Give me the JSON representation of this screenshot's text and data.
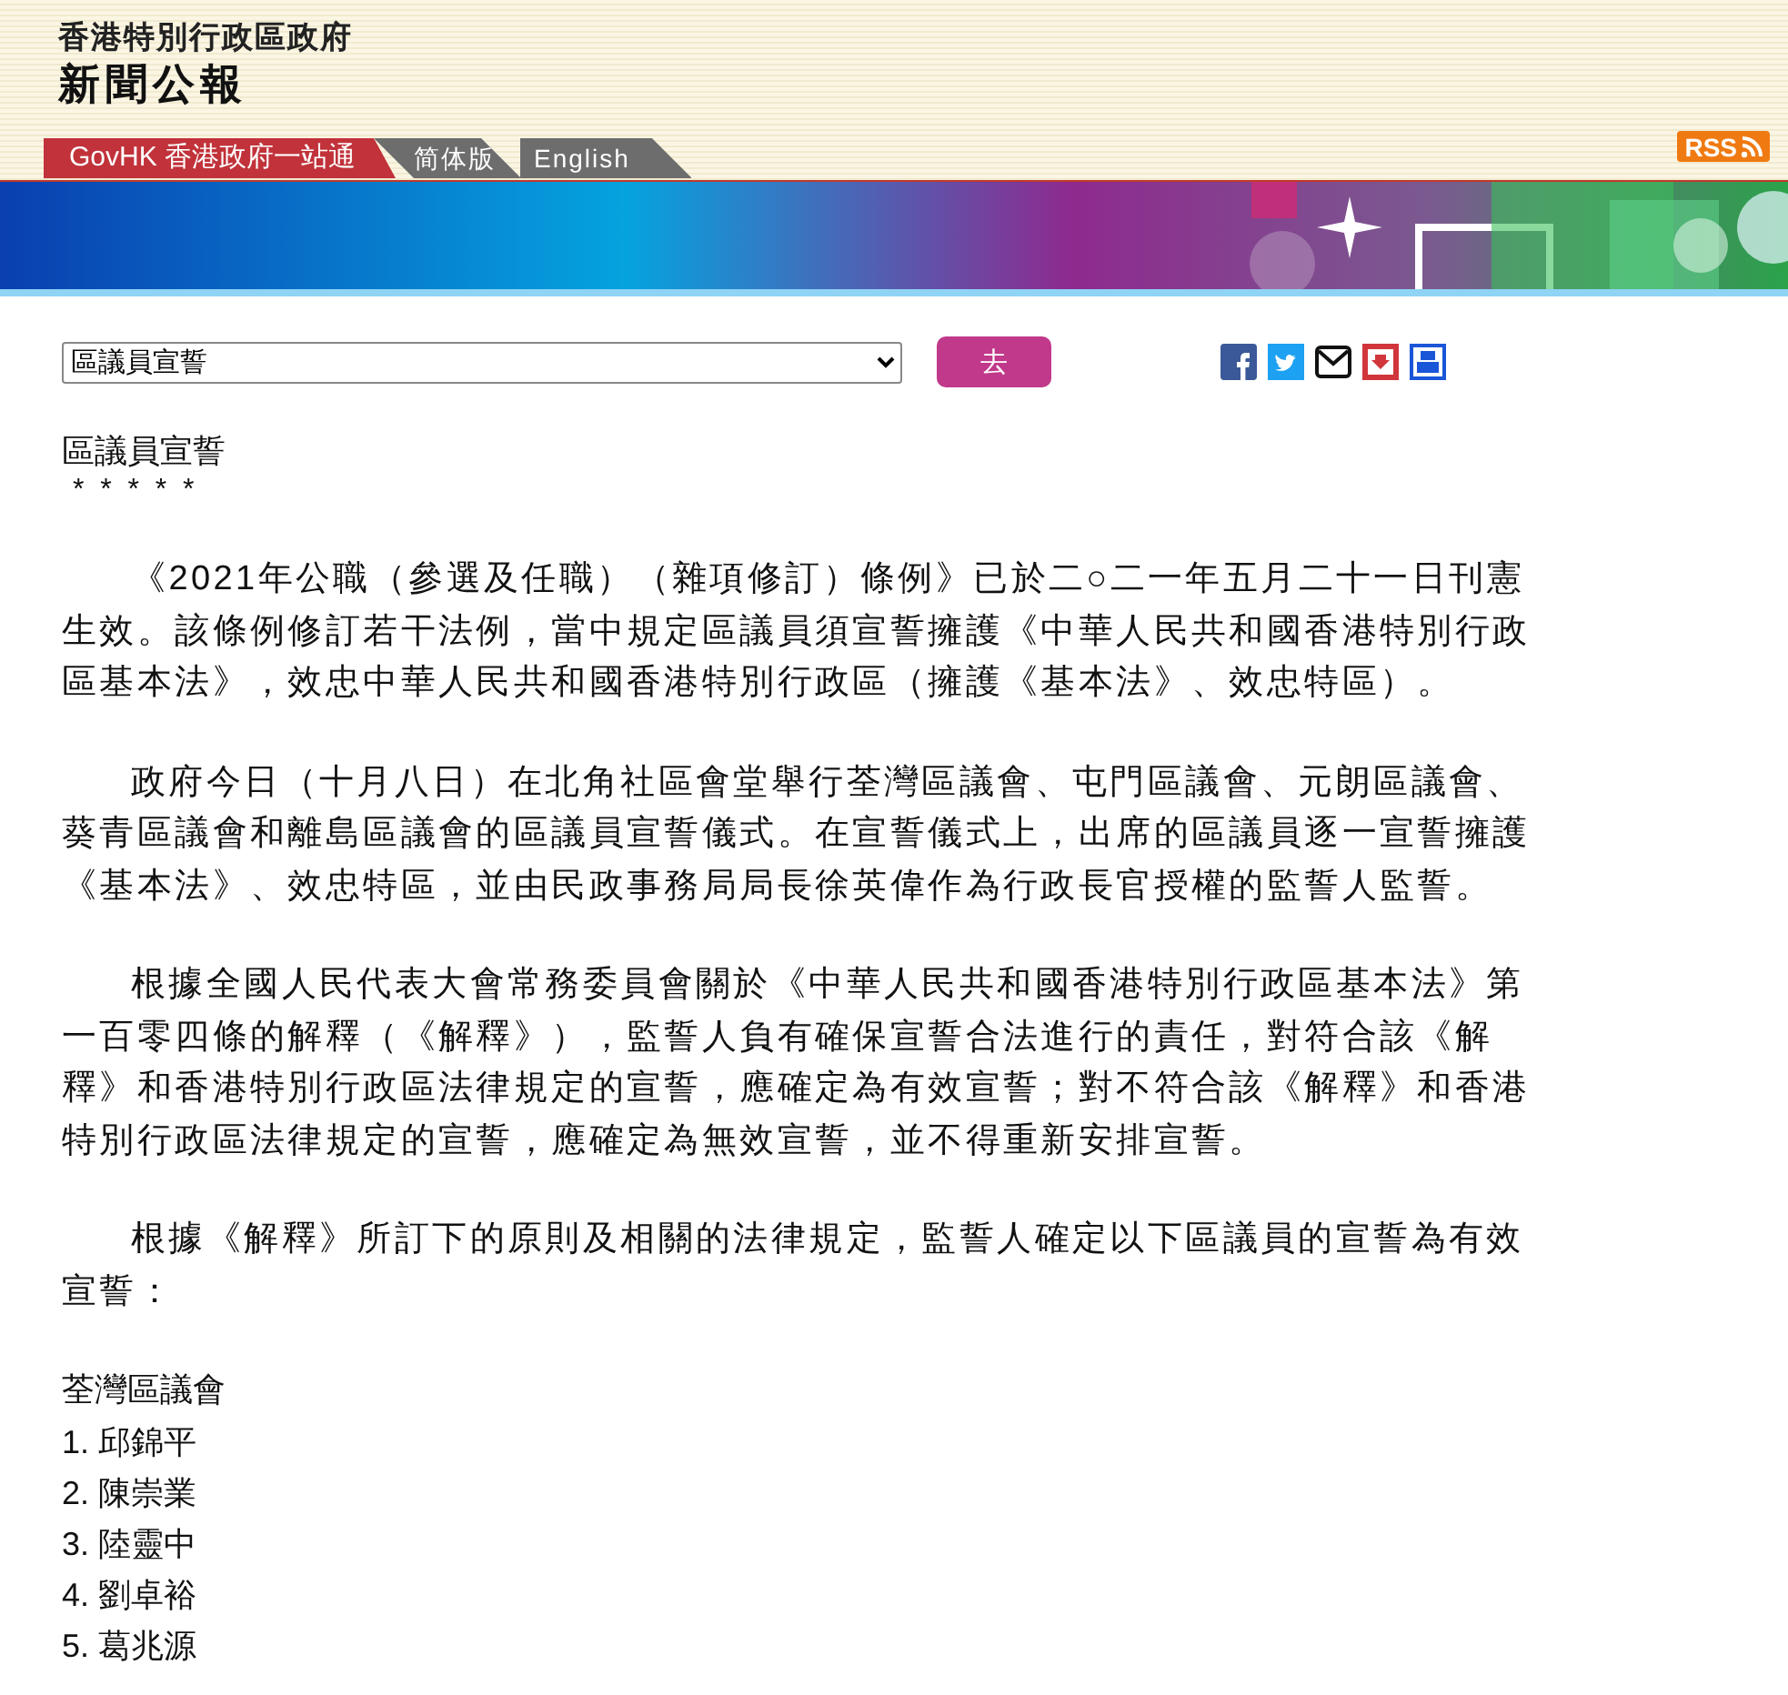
{
  "header": {
    "agency": "香港特別行政區政府",
    "title": "新聞公報"
  },
  "nav": [
    {
      "label": "GovHK 香港政府一站通",
      "kind": "home"
    },
    {
      "label": "简体版",
      "kind": "lang"
    },
    {
      "label": "English",
      "kind": "lang"
    }
  ],
  "rss": {
    "label": "RSS"
  },
  "toolbar": {
    "select_value": "區議員宣誓",
    "go_button": "去"
  },
  "share_icons": [
    {
      "kind": "facebook"
    },
    {
      "kind": "twitter"
    },
    {
      "kind": "email"
    },
    {
      "kind": "download"
    },
    {
      "kind": "print"
    }
  ],
  "article": {
    "title": "區議員宣誓",
    "separator": "*  *  *  *  *",
    "paragraphs": [
      "《2021年公職（參選及任職）（雜項修訂）條例》已於二○二一年五月二十一日刊憲生效。該條例修訂若干法例，當中規定區議員須宣誓擁護《中華人民共和國香港特別行政區基本法》，效忠中華人民共和國香港特別行政區（擁護《基本法》、效忠特區）。",
      "政府今日（十月八日）在北角社區會堂舉行荃灣區議會、屯門區議會、元朗區議會、葵青區議會和離島區議會的區議員宣誓儀式。在宣誓儀式上，出席的區議員逐一宣誓擁護《基本法》、效忠特區，並由民政事務局局長徐英偉作為行政長官授權的監誓人監誓。",
      "根據全國人民代表大會常務委員會關於《中華人民共和國香港特別行政區基本法》第一百零四條的解釋（《解釋》），監誓人負有確保宣誓合法進行的責任，對符合該《解釋》和香港特別行政區法律規定的宣誓，應確定為有效宣誓；對不符合該《解釋》和香港特別行政區法律規定的宣誓，應確定為無效宣誓，並不得重新安排宣誓。",
      "根據《解釋》所訂下的原則及相關的法律規定，監誓人確定以下區議員的宣誓為有效宣誓："
    ],
    "list_heading": "荃灣區議會",
    "members": [
      "1. 邱錦平",
      "2. 陳崇業",
      "3. 陸靈中",
      "4. 劉卓裕",
      "5. 葛兆源"
    ]
  }
}
